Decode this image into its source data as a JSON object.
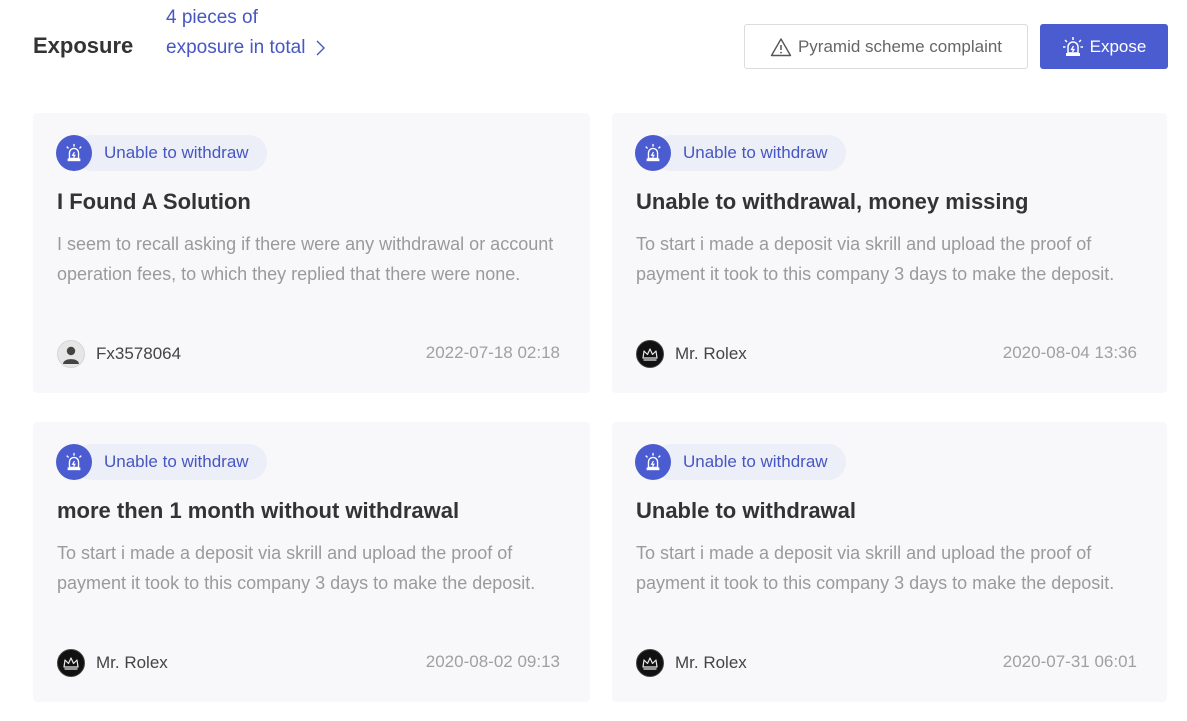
{
  "header": {
    "title": "Exposure",
    "summary": "4 pieces of exposure in total",
    "complaint_label": "Pyramid scheme complaint",
    "expose_label": "Expose"
  },
  "colors": {
    "accent": "#4a5cd0",
    "accent_text": "#4656c2",
    "card_bg": "#f8f8fa",
    "muted": "#9a9a9a"
  },
  "cards": [
    {
      "tag": "Unable to withdraw",
      "title": "I Found A Solution",
      "description": "I seem to recall asking if there were any withdrawal or account operation fees, to which they replied that there were none.",
      "author": "Fx3578064",
      "avatar_icon": "default-user-icon",
      "date": "2022-07-18 02:18"
    },
    {
      "tag": "Unable to withdraw",
      "title": "Unable to withdrawal, money missing",
      "description": "To start i made a deposit via skrill and upload the proof of payment it took to this company 3 days to make the deposit.",
      "author": "Mr. Rolex",
      "avatar_icon": "crown-icon",
      "date": "2020-08-04 13:36"
    },
    {
      "tag": "Unable to withdraw",
      "title": "more then 1 month without withdrawal",
      "description": "To start i made a deposit via skrill and upload the proof of payment it took to this company 3 days to make the deposit.",
      "author": "Mr. Rolex",
      "avatar_icon": "crown-icon",
      "date": "2020-08-02 09:13"
    },
    {
      "tag": "Unable to withdraw",
      "title": "Unable to withdrawal",
      "description": "To start i made a deposit via skrill and upload the proof of payment it took to this company 3 days to make the deposit.",
      "author": "Mr. Rolex",
      "avatar_icon": "crown-icon",
      "date": "2020-07-31 06:01"
    }
  ]
}
